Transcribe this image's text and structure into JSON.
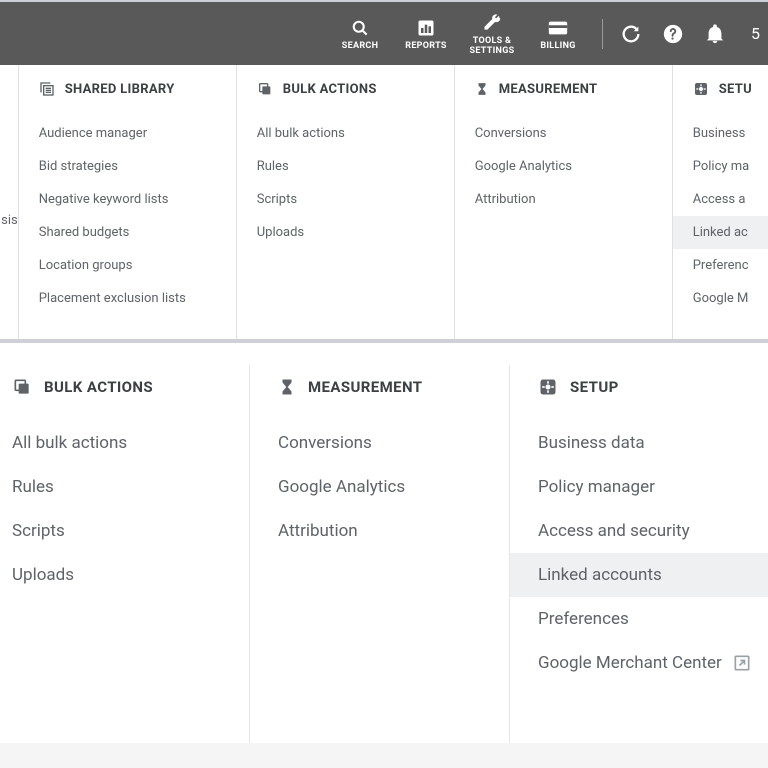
{
  "topbar": {
    "items": [
      {
        "label": "SEARCH"
      },
      {
        "label": "REPORTS"
      },
      {
        "label": "TOOLS &\nSETTINGS"
      },
      {
        "label": "BILLING"
      }
    ],
    "count": "5"
  },
  "panel1": {
    "ghost_trail": "sis",
    "columns": [
      {
        "key": "shared",
        "title": "SHARED LIBRARY",
        "items": [
          "Audience manager",
          "Bid strategies",
          "Negative keyword lists",
          "Shared budgets",
          "Location groups",
          "Placement exclusion lists"
        ]
      },
      {
        "key": "bulk",
        "title": "BULK ACTIONS",
        "items": [
          "All bulk actions",
          "Rules",
          "Scripts",
          "Uploads"
        ]
      },
      {
        "key": "meas",
        "title": "MEASUREMENT",
        "items": [
          "Conversions",
          "Google Analytics",
          "Attribution"
        ]
      },
      {
        "key": "setup",
        "title": "SETU",
        "items": [
          "Business",
          "Policy ma",
          "Access a",
          "Linked ac",
          "Preferenc",
          "Google M"
        ],
        "highlight_index": 3
      }
    ]
  },
  "panel2": {
    "columns": [
      {
        "key": "bulk",
        "title": "BULK ACTIONS",
        "items": [
          "All bulk actions",
          "Rules",
          "Scripts",
          "Uploads"
        ]
      },
      {
        "key": "meas",
        "title": "MEASUREMENT",
        "items": [
          "Conversions",
          "Google Analytics",
          "Attribution"
        ]
      },
      {
        "key": "setup",
        "title": "SETUP",
        "items": [
          "Business data",
          "Policy manager",
          "Access and security",
          "Linked accounts",
          "Preferences",
          "Google Merchant Center"
        ],
        "highlight_index": 3,
        "external_index": 5
      }
    ]
  }
}
